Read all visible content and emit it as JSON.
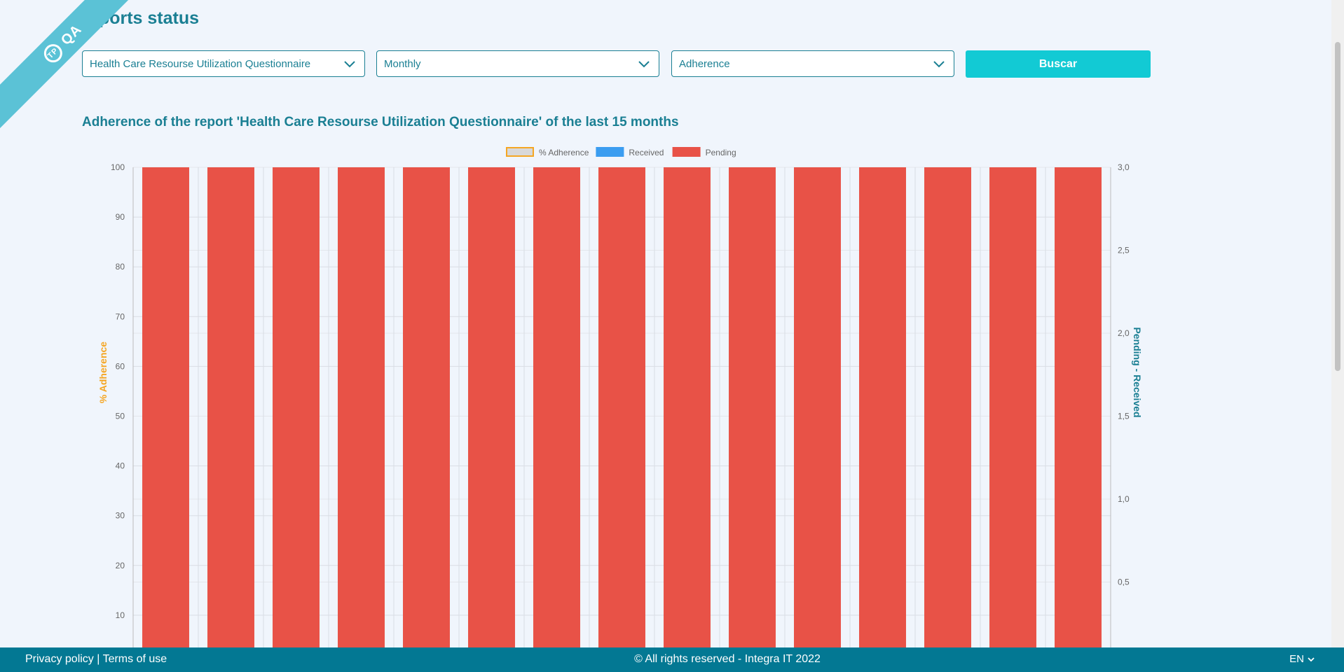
{
  "ribbon": {
    "env_label": "QA",
    "badge": "TP"
  },
  "header": {
    "title": "Reports status"
  },
  "filters": {
    "report_select": "Health Care Resourse Utilization Questionnaire",
    "period_select": "Monthly",
    "metric_select": "Adherence",
    "search_button": "Buscar"
  },
  "chart_title": "Adherence of the report 'Health Care Resourse Utilization Questionnaire' of the last 15 months",
  "chart_data": {
    "type": "bar",
    "legend": [
      "% Adherence",
      "Received",
      "Pending"
    ],
    "ylabel_left": "% Adherence",
    "ylabel_right": "Pending - Received",
    "y_left_ticks": [
      "100",
      "90",
      "80",
      "70",
      "60",
      "50",
      "40",
      "30",
      "20",
      "10"
    ],
    "y_right_ticks": [
      "3,0",
      "2,5",
      "2,0",
      "1,5",
      "1,0",
      "0,5"
    ],
    "ylim_left": [
      0,
      100
    ],
    "ylim_right": [
      0,
      3
    ],
    "bar_count": 15,
    "series": [
      {
        "name": "% Adherence",
        "color": "#d8d8d8",
        "border": "#f5a623",
        "values": [
          0,
          0,
          0,
          0,
          0,
          0,
          0,
          0,
          0,
          0,
          0,
          0,
          0,
          0,
          0
        ]
      },
      {
        "name": "Received",
        "color": "#3b9df0",
        "values": [
          0,
          0,
          0,
          0,
          0,
          0,
          0,
          0,
          0,
          0,
          0,
          0,
          0,
          0,
          0
        ]
      },
      {
        "name": "Pending",
        "color": "#e85247",
        "values": [
          100,
          100,
          100,
          100,
          100,
          100,
          100,
          100,
          100,
          100,
          100,
          100,
          100,
          100,
          100
        ]
      }
    ]
  },
  "footer": {
    "privacy": "Privacy policy",
    "separator": "|",
    "terms": "Terms of use",
    "copyright": "© All rights reserved - Integra IT 2022",
    "language": "EN"
  },
  "colors": {
    "accent": "#1a7f93",
    "button": "#12cad4",
    "footer": "#037893",
    "ribbon": "#5bc2d6"
  }
}
